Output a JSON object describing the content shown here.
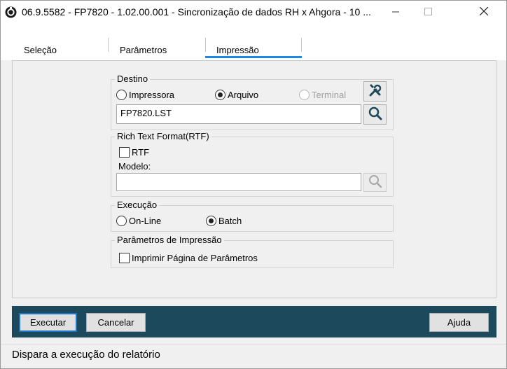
{
  "window": {
    "title": "06.9.5582 - FP7820 - 1.02.00.001 - Sincronização de dados RH x Ahgora - 10 ..."
  },
  "tabs": [
    {
      "label": "Seleção"
    },
    {
      "label": "Parâmetros"
    },
    {
      "label": "Impressão",
      "active": true
    }
  ],
  "destino": {
    "title": "Destino",
    "options": [
      {
        "label": "Impressora",
        "checked": false,
        "enabled": true
      },
      {
        "label": "Arquivo",
        "checked": true,
        "enabled": true
      },
      {
        "label": "Terminal",
        "checked": false,
        "enabled": false
      }
    ],
    "file_value": "FP7820.LST"
  },
  "rtf": {
    "title": "Rich Text Format(RTF)",
    "checkbox_label": "RTF",
    "checked": false,
    "model_label": "Modelo:",
    "model_value": ""
  },
  "execucao": {
    "title": "Execução",
    "options": [
      {
        "label": "On-Line",
        "checked": false
      },
      {
        "label": "Batch",
        "checked": true
      }
    ]
  },
  "param_impressao": {
    "title": "Parâmetros de Impressão",
    "checkbox_label": "Imprimir Página de Parâmetros",
    "checked": false
  },
  "buttons": {
    "execute": "Executar",
    "cancel": "Cancelar",
    "help": "Ajuda"
  },
  "status": {
    "text": "Dispara a execução do relatório"
  },
  "colors": {
    "footer_bg": "#1c4a5c",
    "tab_accent": "#1e88e5",
    "primary_border": "#1e74c8"
  },
  "icons": {
    "app": "logo-icon",
    "tools": "tools-icon",
    "search": "search-icon",
    "minimize": "minimize-icon",
    "maximize": "maximize-icon",
    "close": "close-icon"
  }
}
